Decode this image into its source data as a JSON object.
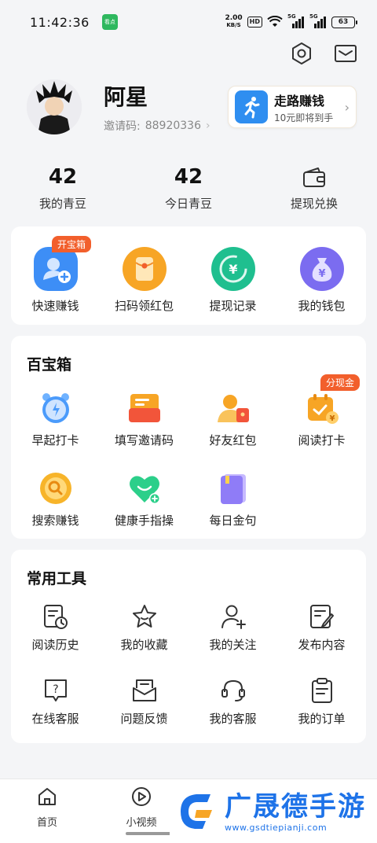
{
  "status_bar": {
    "time": "11:42:36",
    "app_badge": "看点",
    "net_speed_value": "2.00",
    "net_speed_unit": "KB/S",
    "hd": "HD",
    "signal1": "5G",
    "signal2": "5G",
    "battery": "63"
  },
  "profile": {
    "name": "阿星",
    "invite_label": "邀请码:",
    "invite_code": "88920336",
    "walk_title": "走路赚钱",
    "walk_sub": "10元即将到手"
  },
  "stats": [
    {
      "value": "42",
      "label": "我的青豆"
    },
    {
      "value": "42",
      "label": "今日青豆"
    },
    {
      "label": "提现兑换"
    }
  ],
  "quick_actions": {
    "tag": "开宝箱",
    "items": [
      {
        "label": "快速赚钱",
        "icon": "add-user-icon",
        "color": "#3d8ef6"
      },
      {
        "label": "扫码领红包",
        "icon": "red-envelope-icon",
        "color": "#f7a525"
      },
      {
        "label": "提现记录",
        "icon": "yuan-refresh-icon",
        "color": "#1fbf8f"
      },
      {
        "label": "我的钱包",
        "icon": "money-bag-icon",
        "color": "#7b6cf0"
      }
    ]
  },
  "treasure_box": {
    "title": "百宝箱",
    "tag": "分现金",
    "items": [
      {
        "label": "早起打卡",
        "icon": "alarm-clock-icon"
      },
      {
        "label": "填写邀请码",
        "icon": "invite-box-icon"
      },
      {
        "label": "好友红包",
        "icon": "friend-envelope-icon"
      },
      {
        "label": "阅读打卡",
        "icon": "calendar-coin-icon"
      },
      {
        "label": "搜索赚钱",
        "icon": "search-coin-icon"
      },
      {
        "label": "健康手指操",
        "icon": "heart-plus-icon"
      },
      {
        "label": "每日金句",
        "icon": "book-icon"
      }
    ]
  },
  "tools": {
    "title": "常用工具",
    "items": [
      {
        "label": "阅读历史",
        "icon": "reading-history-icon"
      },
      {
        "label": "我的收藏",
        "icon": "star-icon"
      },
      {
        "label": "我的关注",
        "icon": "follow-user-icon"
      },
      {
        "label": "发布内容",
        "icon": "edit-document-icon"
      },
      {
        "label": "在线客服",
        "icon": "question-chat-icon"
      },
      {
        "label": "问题反馈",
        "icon": "feedback-mail-icon"
      },
      {
        "label": "我的客服",
        "icon": "headset-icon"
      },
      {
        "label": "我的订单",
        "icon": "clipboard-icon"
      }
    ]
  },
  "bottom_nav": [
    {
      "label": "首页",
      "icon": "home-icon"
    },
    {
      "label": "小视频",
      "icon": "play-icon"
    }
  ],
  "watermark": {
    "title": "广晟德手游",
    "url": "www.gsdtiepianji.com"
  },
  "colors": {
    "background": "#f4f5f7",
    "tag_orange": "#f25f2c",
    "watermark_blue": "#1e73e8"
  }
}
